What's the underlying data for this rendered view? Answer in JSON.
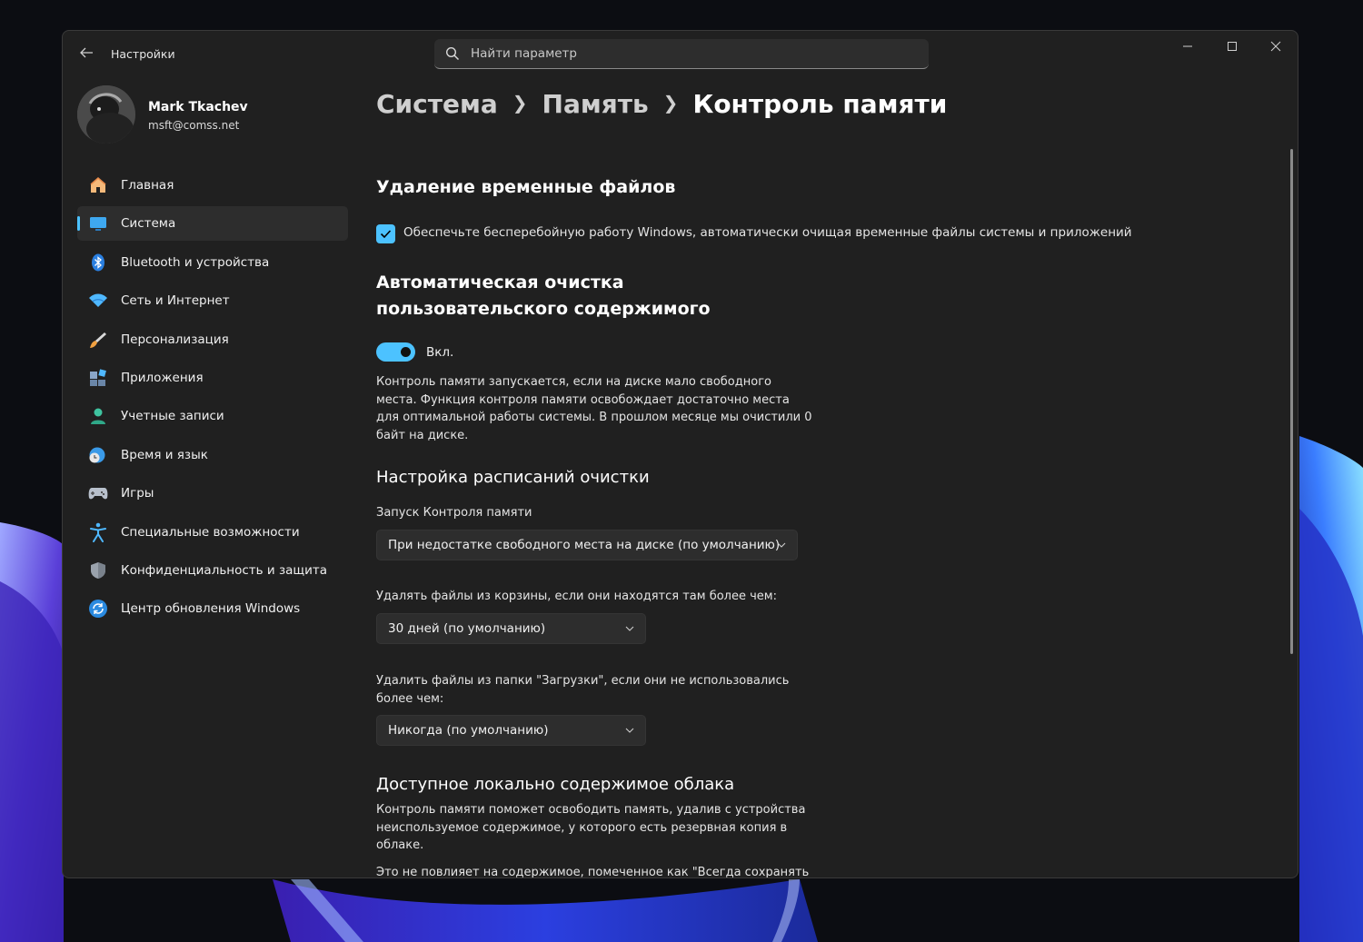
{
  "window": {
    "app_title": "Настройки",
    "search_placeholder": "Найти параметр"
  },
  "profile": {
    "name": "Mark Tkachev",
    "email": "msft@comss.net"
  },
  "sidebar": {
    "items": [
      {
        "label": "Главная",
        "icon": "home-icon"
      },
      {
        "label": "Система",
        "icon": "monitor-icon",
        "active": true
      },
      {
        "label": "Bluetooth и устройства",
        "icon": "bluetooth-icon"
      },
      {
        "label": "Сеть и Интернет",
        "icon": "wifi-icon"
      },
      {
        "label": "Персонализация",
        "icon": "brush-icon"
      },
      {
        "label": "Приложения",
        "icon": "apps-icon"
      },
      {
        "label": "Учетные записи",
        "icon": "person-icon"
      },
      {
        "label": "Время и язык",
        "icon": "globe-clock-icon"
      },
      {
        "label": "Игры",
        "icon": "gamepad-icon"
      },
      {
        "label": "Специальные возможности",
        "icon": "accessibility-icon"
      },
      {
        "label": "Конфиденциальность и защита",
        "icon": "shield-icon"
      },
      {
        "label": "Центр обновления Windows",
        "icon": "update-icon"
      }
    ]
  },
  "breadcrumb": {
    "level1": "Система",
    "level2": "Память",
    "current": "Контроль памяти"
  },
  "temp_files": {
    "heading": "Удаление временные файлов",
    "checkbox_label": "Обеспечьте бесперебойную работу Windows, автоматически очищая временные файлы системы и приложений",
    "checked": true
  },
  "auto_cleanup": {
    "heading": "Автоматическая очистка пользовательского содержимого",
    "toggle_state": "Вкл.",
    "toggle_on": true,
    "description": "Контроль памяти запускается, если на диске мало свободного места. Функция контроля памяти освобождает достаточно места для оптимальной работы системы. В прошлом месяце мы очистили 0 байт на диске."
  },
  "schedule": {
    "heading": "Настройка расписаний очистки",
    "run_label": "Запуск Контроля памяти",
    "run_value": "При недостатке свободного места на диске (по умолчанию)",
    "recycle_label": "Удалять файлы из корзины, если они находятся там более чем:",
    "recycle_value": "30 дней (по умолчанию)",
    "downloads_label": "Удалить файлы из папки \"Загрузки\", если они не использовались более чем:",
    "downloads_value": "Никогда (по умолчанию)"
  },
  "cloud": {
    "heading": "Доступное локально содержимое облака",
    "description1": "Контроль памяти поможет освободить память, удалив с устройства неиспользуемое содержимое, у которого есть резервная копия в облаке.",
    "description2": "Это не повлияет на содержимое, помеченное как \"Всегда сохранять на этом устройстве\"."
  },
  "colors": {
    "accent": "#4cc2ff",
    "window_bg": "#202020",
    "control_bg": "#2d2d2d"
  }
}
